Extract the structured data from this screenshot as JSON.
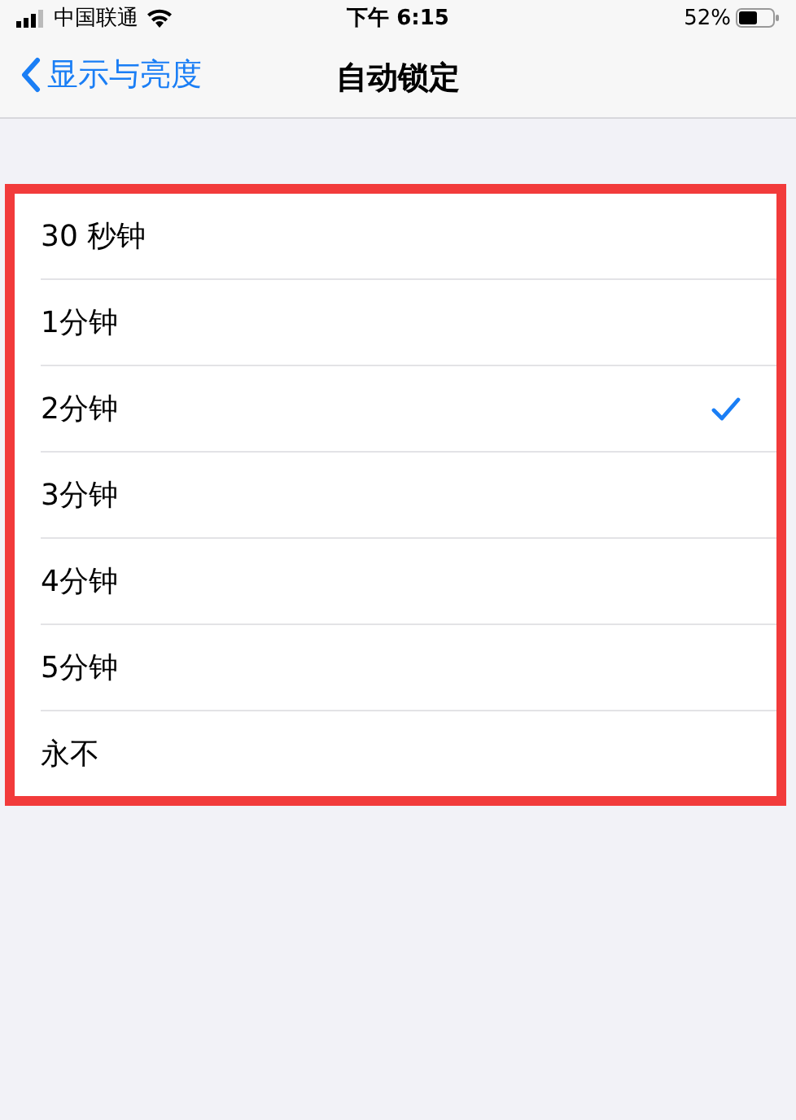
{
  "status_bar": {
    "carrier": "中国联通",
    "time": "下午 6:15",
    "battery": "52%"
  },
  "nav_bar": {
    "back": "显示与亮度",
    "title": "自动锁定"
  },
  "options": {
    "highlighted": true,
    "items": [
      {
        "label": "30 秒钟",
        "selected": false
      },
      {
        "label": "1分钟",
        "selected": false
      },
      {
        "label": "2分钟",
        "selected": true
      },
      {
        "label": "3分钟",
        "selected": false
      },
      {
        "label": "4分钟",
        "selected": false
      },
      {
        "label": "5分钟",
        "selected": false
      },
      {
        "label": "永不",
        "selected": false
      }
    ]
  }
}
